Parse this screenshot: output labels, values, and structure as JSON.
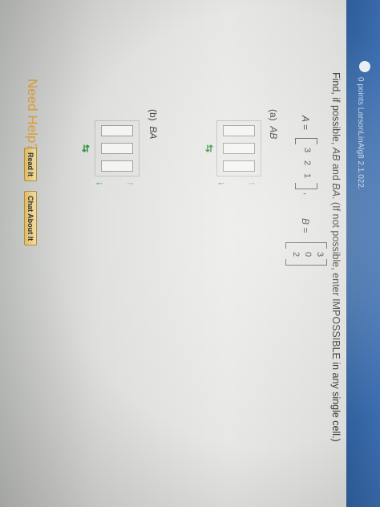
{
  "header": {
    "title": "0 points   LarsonLinAlg8 2.1.022."
  },
  "problem": {
    "prompt_prefix": "Find, if possible, ",
    "prompt_ab": "AB",
    "prompt_and": " and ",
    "prompt_ba": "BA",
    "prompt_suffix": ". (If not possible, enter IMPOSSIBLE in any single cell.)",
    "matrix_a_label": "A =",
    "matrix_a_entries": [
      "3",
      "2",
      "1"
    ],
    "comma": ",",
    "matrix_b_label": "B =",
    "matrix_b_entries": [
      "3",
      "0",
      "2"
    ]
  },
  "part_a": {
    "label": "(a)",
    "product": "AB"
  },
  "part_b": {
    "label": "(b)",
    "product": "BA"
  },
  "help": {
    "need_help": "Need Help?",
    "read_it": "Read It",
    "chat_about_it": "Chat About It"
  },
  "arrows": {
    "left_right": "⇆",
    "up": "↑",
    "down": "↓"
  }
}
